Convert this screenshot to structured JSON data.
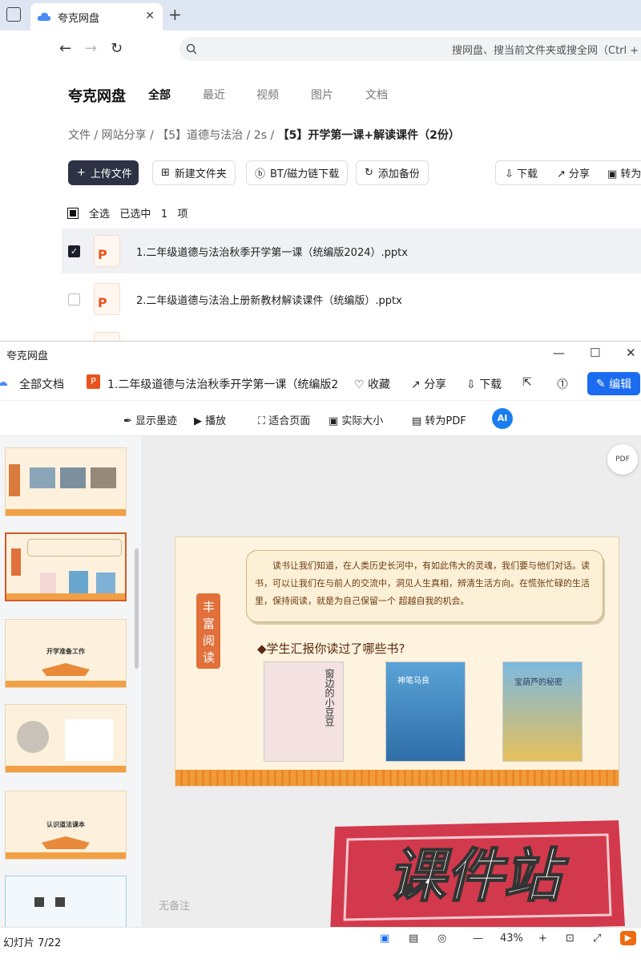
{
  "browser": {
    "tab_title": "夸克网盘",
    "address_placeholder": "搜网盘、搜当前文件夹或搜全网（Ctrl + F）"
  },
  "drive": {
    "brand": "夸克网盘",
    "categories": [
      "全部",
      "最近",
      "视频",
      "图片",
      "文档"
    ],
    "breadcrumb": [
      "文件",
      "网站分享",
      "【5】道德与法治",
      "2s",
      "【5】开学第一课+解读课件（2份）"
    ],
    "actions": {
      "upload": "上传文件",
      "new_folder": "新建文件夹",
      "bt_download": "BT/磁力链下载",
      "add_backup": "添加备份",
      "download": "下载",
      "share": "分享",
      "convert": "转为"
    },
    "selection": {
      "select_all": "全选",
      "selected_prefix": "已选中",
      "count": "1",
      "unit": "项"
    },
    "files": [
      {
        "name": "1.二年级道德与法治秋季开学第一课（统编版2024）.pptx",
        "selected": true
      },
      {
        "name": "2.二年级道德与法治上册新教材解读课件（统编版）.pptx",
        "selected": false
      }
    ]
  },
  "viewer": {
    "window_title": "夸克网盘",
    "all_docs": "全部文档",
    "doc_title": "1.二年级道德与法治秋季开学第一课（统编版2",
    "favorite": "收藏",
    "share": "分享",
    "download": "下载",
    "edit": "编辑",
    "toolbar": {
      "show_ink": "显示墨迹",
      "play": "播放",
      "fit_page": "适合页面",
      "actual_size": "实际大小",
      "to_pdf": "转为PDF",
      "ai": "AI"
    },
    "thumbnails": [
      {
        "title": ""
      },
      {
        "title": ""
      },
      {
        "title": "开学准备工作"
      },
      {
        "title": ""
      },
      {
        "title": "认识道法课本"
      },
      {
        "title": ""
      }
    ],
    "slide": {
      "side_label": "丰富阅读",
      "quote": "读书让我们知道，在人类历史长河中，有如此伟大的灵魂，我们要与他们对话。读书，可以让我们在与前人的交流中，洞见人生真相，辨清生活方向。在慌张忙碌的生活里，保持阅读，就是为自己保留一个 超越自我的机会。",
      "question": "◆学生汇报你读过了哪些书?",
      "books": [
        "窗边的小豆豆",
        "神笔马良",
        "宝葫芦的秘密"
      ]
    },
    "notes": "无备注",
    "watermark": "课件站",
    "status": {
      "slide_counter": "幻灯片 7/22",
      "zoom": "43%"
    }
  }
}
